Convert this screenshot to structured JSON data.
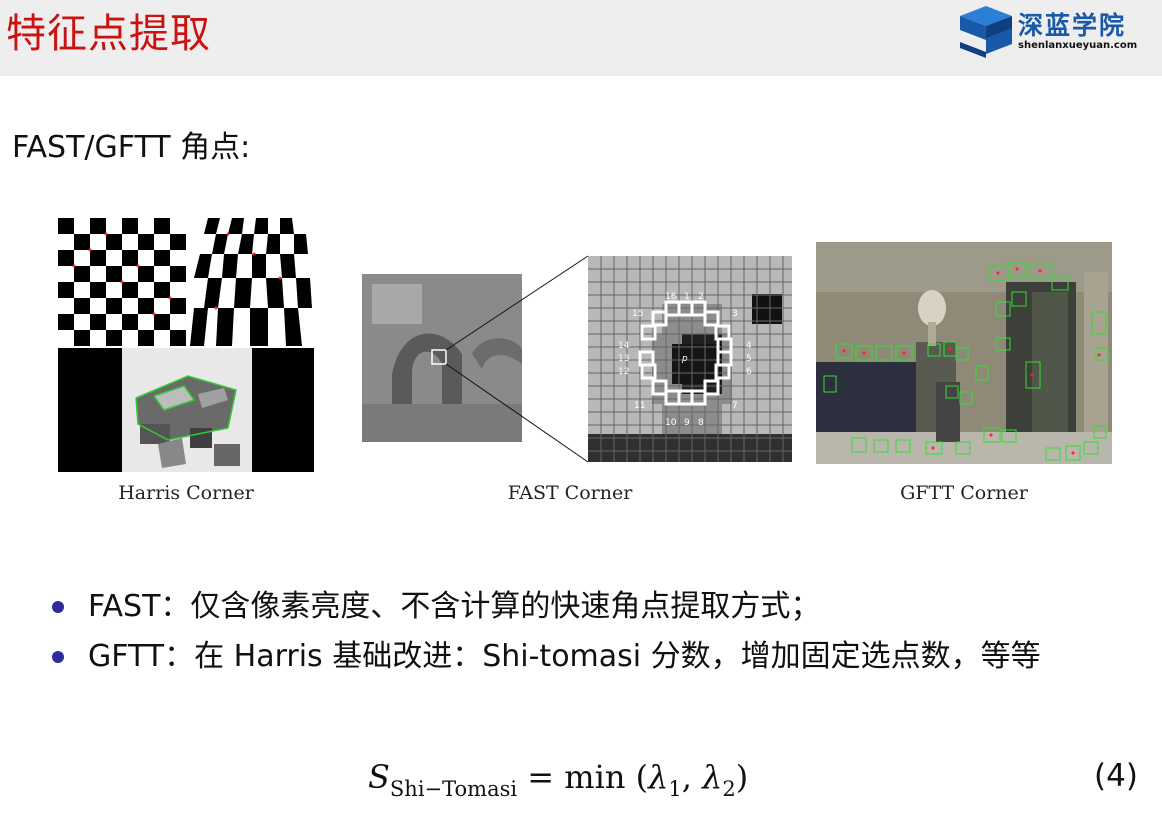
{
  "header": {
    "title": "特征点提取",
    "logo_cn": "深蓝学院",
    "logo_en": "shenlanxueyuan.com",
    "title_color": "#cc1111",
    "logo_color": "#1a58a8"
  },
  "subtitle": "FAST/GFTT 角点:",
  "figures": [
    {
      "caption": "Harris Corner"
    },
    {
      "caption": "FAST Corner",
      "labels": [
        "16",
        "1",
        "2",
        "15",
        "3",
        "14",
        "4",
        "13",
        "5",
        "12",
        "6",
        "11",
        "7",
        "10",
        "9",
        "8",
        "p"
      ]
    },
    {
      "caption": "GFTT Corner"
    }
  ],
  "bullets": [
    "FAST：仅含像素亮度、不含计算的快速角点提取方式；",
    "GFTT：在 Harris 基础改进：Shi-tomasi 分数，增加固定选点数，等等"
  ],
  "formula": {
    "lhs": "S",
    "lhs_sub": "Shi−Tomasi",
    "rhs_pre": " = min (",
    "l1": "λ",
    "sub1": "1",
    "comma": ", ",
    "l2": "λ",
    "sub2": "2",
    "close": ")",
    "number": "(4)"
  }
}
